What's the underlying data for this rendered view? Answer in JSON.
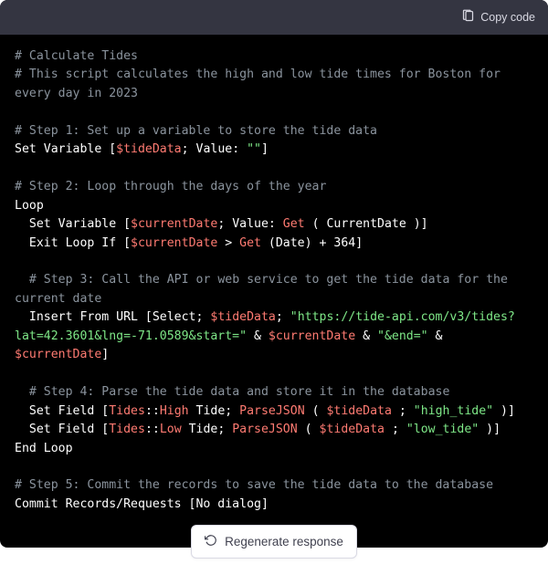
{
  "header": {
    "copy_label": "Copy code"
  },
  "code": {
    "l1": "# Calculate Tides",
    "l2": "# This script calculates the high and low tide times for Boston for every day in 2023",
    "l3": "# Step 1: Set up a variable to store the tide data",
    "l4a": "Set Variable [",
    "l4b": "$tideData",
    "l4c": "; Value: ",
    "l4d": "\"\"",
    "l4e": "]",
    "l5": "# Step 2: Loop through the days of the year",
    "l6": "Loop",
    "l7a": "  Set Variable [",
    "l7b": "$currentDate",
    "l7c": "; Value: ",
    "l7d": "Get",
    "l7e": " ( CurrentDate )]",
    "l8a": "  Exit Loop If [",
    "l8b": "$currentDate",
    "l8c": " > ",
    "l8d": "Get",
    "l8e": " (Date) + 364]",
    "l9": "  # Step 3: Call the API or web service to get the tide data for the current date",
    "l10a": "  Insert From URL [Select; ",
    "l10b": "$tideData",
    "l10c": "; ",
    "l10d": "\"https://tide-api.com/v3/tides?lat=42.3601&lng=-71.0589&start=\"",
    "l10e": " & ",
    "l10f": "$currentDate",
    "l10g": " & ",
    "l10h": "\"&end=\"",
    "l10i": " & ",
    "l10j": "$currentDate",
    "l10k": "]",
    "l11": "  # Step 4: Parse the tide data and store it in the database",
    "l12a": "  Set Field [",
    "l12b": "Tides",
    "l12c": "::",
    "l12d": "High",
    "l12e": " Tide; ",
    "l12f": "ParseJSON",
    "l12g": " ( ",
    "l12h": "$tideData",
    "l12i": " ; ",
    "l12j": "\"high_tide\"",
    "l12k": " )]",
    "l13a": "  Set Field [",
    "l13b": "Tides",
    "l13c": "::",
    "l13d": "Low",
    "l13e": " Tide; ",
    "l13f": "ParseJSON",
    "l13g": " ( ",
    "l13h": "$tideData",
    "l13i": " ; ",
    "l13j": "\"low_tide\"",
    "l13k": " )]",
    "l14": "End Loop",
    "l15": "# Step 5: Commit the records to save the tide data to the database",
    "l16": "Commit Records/Requests [No dialog]"
  },
  "footer": {
    "regenerate_label": "Regenerate response"
  }
}
